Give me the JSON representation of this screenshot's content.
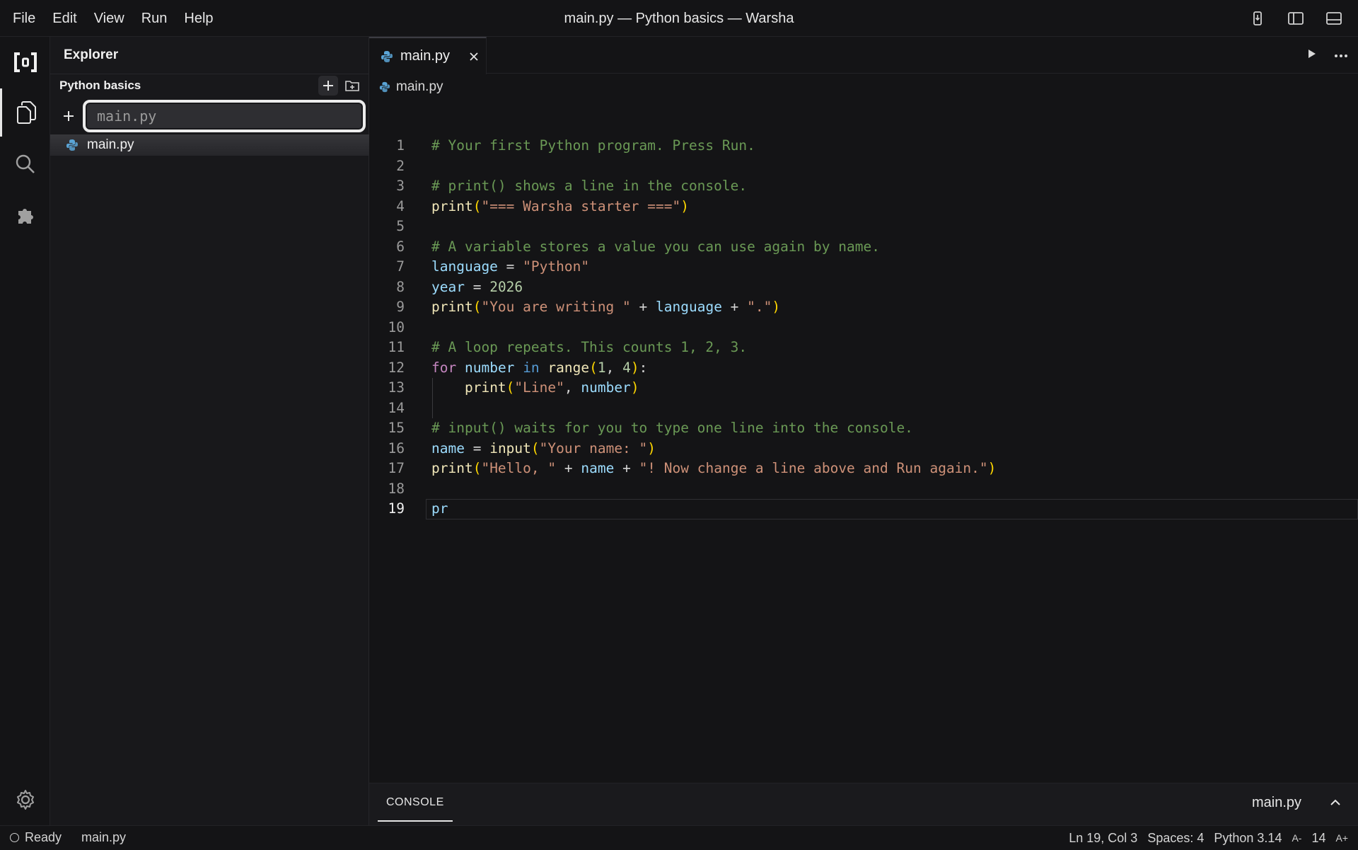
{
  "menu": [
    "File",
    "Edit",
    "View",
    "Run",
    "Help"
  ],
  "window_title": "main.py — Python basics — Warsha",
  "sidebar": {
    "title": "Explorer",
    "folder": "Python basics",
    "new_file_input": {
      "value": "",
      "placeholder": "main.py"
    },
    "files": [
      "main.py"
    ]
  },
  "editor": {
    "tab": "main.py",
    "breadcrumb": "main.py",
    "current_line": 19,
    "lines": [
      "# Your first Python program. Press Run.",
      "",
      "# print() shows a line in the console.",
      "print(\"=== Warsha starter ===\")",
      "",
      "# A variable stores a value you can use again by name.",
      "language = \"Python\"",
      "year = 2026",
      "print(\"You are writing \" + language + \".\")",
      "",
      "# A loop repeats. This counts 1, 2, 3.",
      "for number in range(1, 4):",
      "    print(\"Line\", number)",
      "",
      "# input() waits for you to type one line into the console.",
      "name = input(\"Your name: \")",
      "print(\"Hello, \" + name + \"! Now change a line above and Run again.\")",
      "",
      "pr"
    ]
  },
  "panel": {
    "tab": "CONSOLE",
    "file": "main.py"
  },
  "status": {
    "state": "Ready",
    "file": "main.py",
    "cursor": "Ln 19, Col 3",
    "spaces": "Spaces: 4",
    "language": "Python 3.14",
    "font_decrease": "A-",
    "font_size": "14",
    "font_increase": "A+"
  }
}
